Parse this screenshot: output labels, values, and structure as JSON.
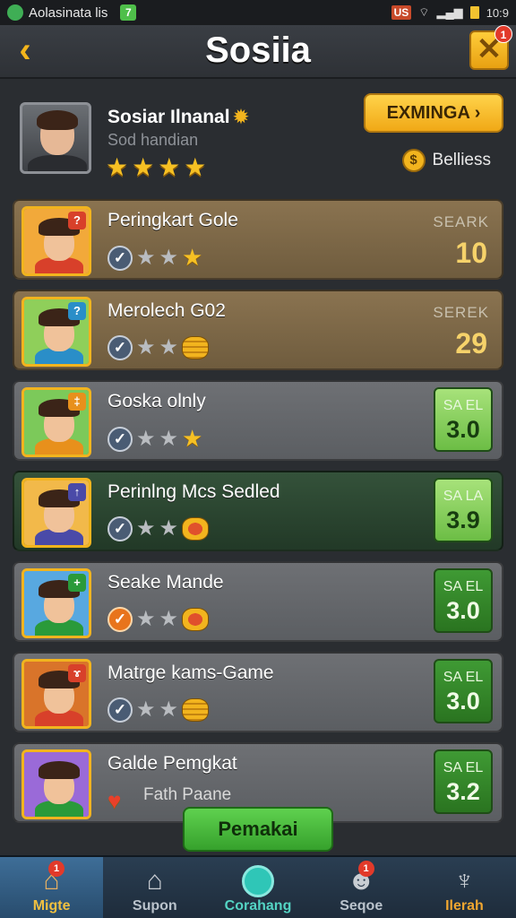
{
  "status_bar": {
    "app_title": "Aolasinata lis",
    "carrier": "US",
    "time": "10:9"
  },
  "header": {
    "title": "Sosiia",
    "close_badge": "1"
  },
  "profile": {
    "name": "Sosiar Ilnanal",
    "subtitle": "Sod handian",
    "stars": 4,
    "action_label": "EXMINGA",
    "currency_label": "Belliess"
  },
  "games": [
    {
      "title": "Peringkart Gole",
      "score_label": "SEARK",
      "score": "10",
      "theme": "brown",
      "rating_icon": "check",
      "reward": "star",
      "thumb_color": "#f2a93a",
      "badge_color": "#d8402a",
      "badge": "?"
    },
    {
      "title": "Merolech G02",
      "score_label": "SEREK",
      "score": "29",
      "theme": "brown",
      "rating_icon": "check",
      "reward": "coins",
      "thumb_color": "#8fcf5a",
      "badge_color": "#2a8ec8",
      "badge": "?"
    },
    {
      "title": "Goska olnly",
      "score_label": "SA EL",
      "score": "3.0",
      "theme": "gray",
      "rating_icon": "check",
      "reward": "star",
      "thumb_color": "#7cc95a",
      "badge_color": "#e8901c",
      "badge": "‡"
    },
    {
      "title": "Perinlng Mcs Sedled",
      "score_label": "SA LA",
      "score": "3.9",
      "theme": "green",
      "rating_icon": "check",
      "reward": "red-coins",
      "thumb_color": "#f2b94a",
      "badge_color": "#4a4aa8",
      "badge": "↑"
    },
    {
      "title": "Seake  Mande",
      "score_label": "SA EL",
      "score": "3.0",
      "theme": "gray",
      "rating_icon": "check-orange",
      "reward": "red-coins",
      "thumb_color": "#58a8e0",
      "badge_color": "#2a9a3a",
      "badge": "+"
    },
    {
      "title": "Matrge kams-Game",
      "score_label": "SA EL",
      "score": "3.0",
      "theme": "gray",
      "rating_icon": "check",
      "reward": "coins",
      "thumb_color": "#d9742a",
      "badge_color": "#d8402a",
      "badge": "ɤ"
    },
    {
      "title": "Galde Pemgkat",
      "subtitle": "Fath Paane",
      "score_label": "SA EL",
      "score": "3.2",
      "theme": "gray",
      "rating_icon": "heart",
      "reward": "none",
      "thumb_color": "#9a6ad8",
      "badge_color": "#2a9a3a",
      "badge": ""
    }
  ],
  "float_button": "Pemakai",
  "nav": [
    {
      "label": "Migte",
      "icon": "home-icon",
      "badge": "1"
    },
    {
      "label": "Supon",
      "icon": "house-icon"
    },
    {
      "label": "Corahang",
      "icon": "chat-icon"
    },
    {
      "label": "Seqoe",
      "icon": "character-icon",
      "badge": "1"
    },
    {
      "label": "Ilerah",
      "icon": "trophy-icon"
    }
  ]
}
